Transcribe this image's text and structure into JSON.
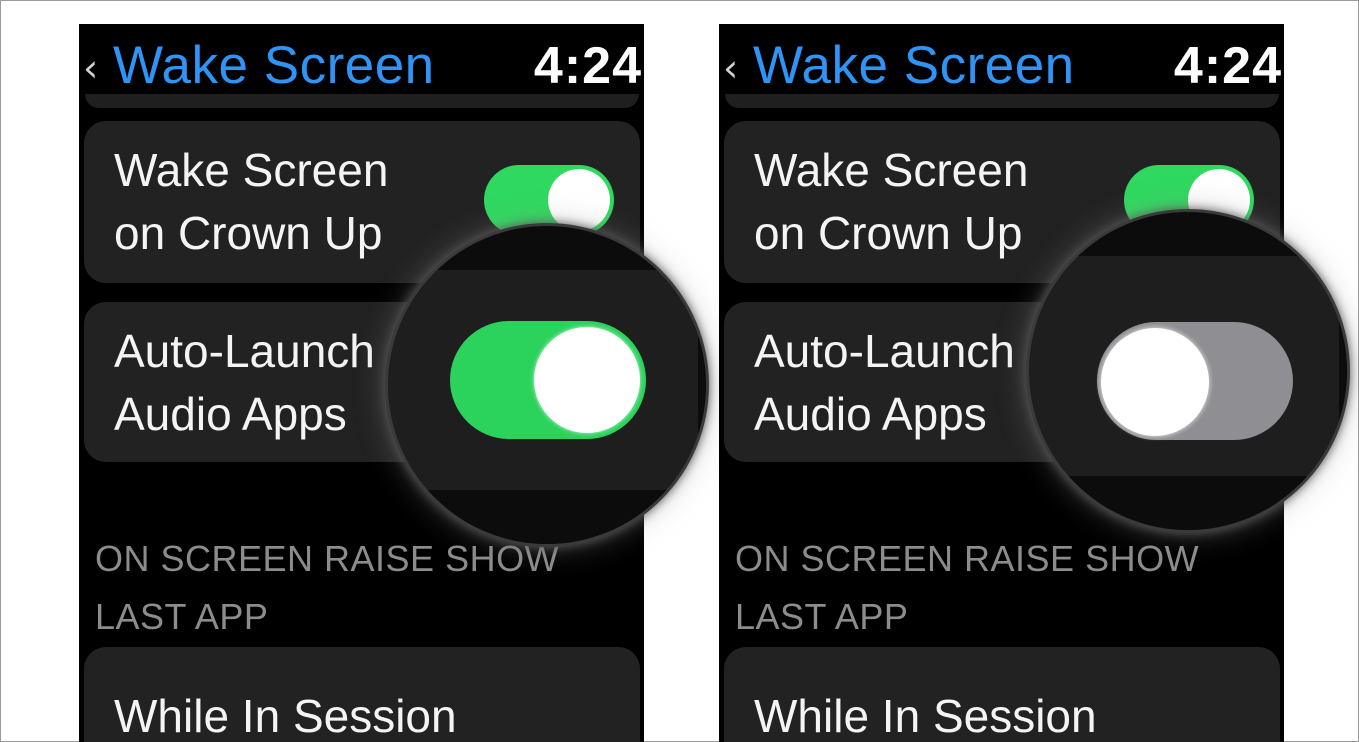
{
  "screens": [
    {
      "back_glyph": "‹",
      "title": "Wake Screen",
      "time": "4:24",
      "crown_row": {
        "label": "Wake Screen\non Crown Up",
        "toggle_on": true
      },
      "audio_row": {
        "label": "Auto-Launch\nAudio Apps",
        "toggle_on": true
      },
      "section_header": "ON SCREEN RAISE SHOW LAST APP",
      "session_row": {
        "label": "While In Session"
      }
    },
    {
      "back_glyph": "‹",
      "title": "Wake Screen",
      "time": "4:24",
      "crown_row": {
        "label": "Wake Screen\non Crown Up",
        "toggle_on": true
      },
      "audio_row": {
        "label": "Auto-Launch\nAudio Apps",
        "toggle_on": false
      },
      "section_header": "ON SCREEN RAISE SHOW LAST APP",
      "session_row": {
        "label": "While In Session"
      }
    }
  ],
  "colors": {
    "title_blue": "#2e94f5",
    "toggle_on_green": "#2fd85e",
    "toggle_off_gray": "#8e8e93",
    "cell_background": "#222222",
    "section_gray": "#8c8c8c"
  }
}
